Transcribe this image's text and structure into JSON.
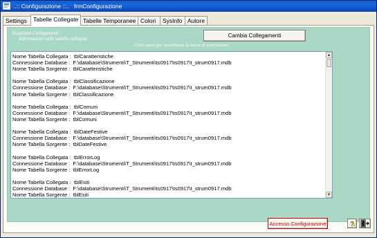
{
  "window": {
    "title": "..:: Configurazione ::..   frmConfigurazione"
  },
  "tabs": [
    {
      "label": "Settings",
      "active": false
    },
    {
      "label": "Tabelle Collegate",
      "active": true
    },
    {
      "label": "Tabelle Temporanee",
      "active": false
    },
    {
      "label": "Colori",
      "active": false
    },
    {
      "label": "SysInfo",
      "active": false
    },
    {
      "label": "Autore",
      "active": false
    }
  ],
  "panel": {
    "title": "Visualizza Collegamenti -",
    "subtitle": "Informazioni sulle tabelle collegate",
    "hint": "Click sopra per visualizzare la barra di scorrimento",
    "cambia_button": "Cambia Collegamenti",
    "list_text": "Nome Tabella Collegata :  tblCaratteristiche\nConnessione Database :  F:\\database\\Strumenti\\T_Strumenti\\ts0917\\ts0917\\t_strum0917.mdb\nNome Tabella Sorgente :  tblCaratteristiche\n\nNome Tabella Collegata :  tblClassificazione\nConnessione Database :  F:\\database\\Strumenti\\T_Strumenti\\ts0917\\ts0917\\t_strum0917.mdb\nNome Tabella Sorgente :  tblClassificazione\n\nNome Tabella Collegata :  tblComuni\nConnessione Database :  F:\\database\\Strumenti\\T_Strumenti\\ts0917\\ts0917\\t_strum0917.mdb\nNome Tabella Sorgente :  tblComuni\n\nNome Tabella Collegata :  tblDateFestive\nConnessione Database :  F:\\database\\Strumenti\\T_Strumenti\\ts0917\\ts0917\\t_strum0917.mdb\nNome Tabella Sorgente :  tblDateFestive\n\nNome Tabella Collegata :  tblErrorLog\nConnessione Database :  F:\\database\\Strumenti\\T_Strumenti\\ts0917\\ts0917\\t_strum0917.mdb\nNome Tabella Sorgente :  tblErrorLog\n\nNome Tabella Collegata :  tblEsiti\nConnessione Database :  F:\\database\\Strumenti\\T_Strumenti\\ts0917\\ts0917\\t_strum0917.mdb\nNome Tabella Sorgente :  tblEsiti\n\nNome Tabella Collegata :  tblFornitori"
  },
  "footer": {
    "accesso_button": "Accesso Configurazione",
    "help_icon": "question-mark-icon",
    "exit_icon": "exit-door-icon"
  },
  "colors": {
    "panel_green": "#a9d9c6",
    "accent_red": "#d10000",
    "titlebar_blue": "#0a5fd6"
  }
}
